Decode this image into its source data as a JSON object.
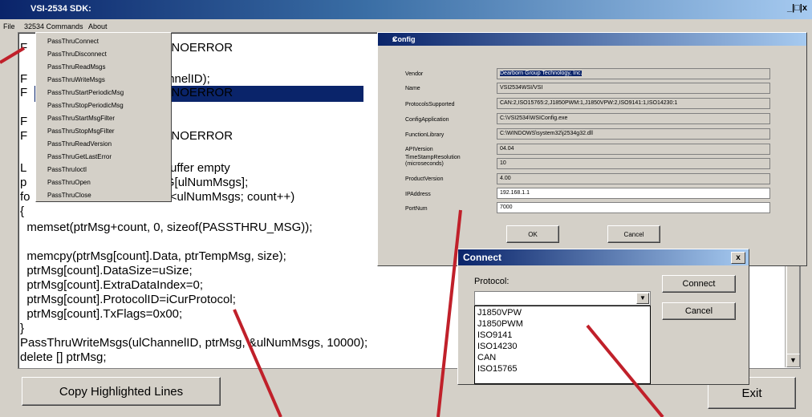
{
  "window": {
    "title": "VSI-2534 SDK:",
    "controls": "_|□|x"
  },
  "menubar": {
    "items": [
      "File",
      "32534 Commands",
      "About"
    ]
  },
  "dropdown": {
    "items": [
      "PassThruConnect",
      "PassThruDisconnect",
      "PassThruReadMsgs",
      "PassThruWriteMsgs",
      "PassThruStartPeriodicMsg",
      "PassThruStopPeriodicMsg",
      "PassThruStartMsgFilter",
      "PassThruStopMsgFilter",
      "PassThruReadVersion",
      "PassThruGetLastError",
      "PassThruIoctl",
      "PassThruOpen",
      "PassThruClose"
    ]
  },
  "code": {
    "lines": [
      "F                                    US_NOERROR",
      "F                                      hannelID);",
      "F                                    US_NOERROR",
      "F",
      "F                                    US_NOERROR",
      "L                                  age buffer empty",
      "p                                  _MSG[ulNumMsgs];",
      "fo                                 count<ulNumMsgs; count++)",
      "{",
      "  memset(ptrMsg+count, 0, sizeof(PASSTHRU_MSG));",
      "  memcpy(ptrMsg[count].Data, ptrTempMsg, size);",
      "  ptrMsg[count].DataSize=uSize;",
      "  ptrMsg[count].ExtraDataIndex=0;",
      "  ptrMsg[count].ProtocolID=iCurProtocol;",
      "  ptrMsg[count].TxFlags=0x00;",
      "}",
      "PassThruWriteMsgs(ulChannelID, ptrMsg, &ulNumMsgs, 10000);",
      "delete [] ptrMsg;"
    ]
  },
  "buttons": {
    "copy": "Copy Highlighted Lines",
    "exit": "Exit"
  },
  "config": {
    "title": "Config",
    "close": "x",
    "fields": [
      {
        "label": "Vendor",
        "value": "Dearborn Group Technology, Inc."
      },
      {
        "label": "Name",
        "value": "VSI2534WSI/VSI"
      },
      {
        "label": "ProtocolsSupported",
        "value": "CAN:2,ISO15765:2,J1850PWM:1,J1850VPW:2,ISO9141:1,ISO14230:1"
      },
      {
        "label": "ConfigApplication",
        "value": "C:\\VSI2534\\WSIConfig.exe"
      },
      {
        "label": "FunctionLibrary",
        "value": "C:\\WINDOWS\\system32\\j2534g32.dll"
      },
      {
        "label": "APIVersion",
        "value": "04.04"
      },
      {
        "label": "TimeStampResolution (microseconds)",
        "value": "10"
      },
      {
        "label": "ProductVersion",
        "value": "4.00"
      },
      {
        "label": "IPAddress",
        "value": "192.168.1.1"
      },
      {
        "label": "PortNum",
        "value": "7000"
      }
    ],
    "ok": "OK",
    "cancel": "Cancel"
  },
  "connect": {
    "title": "Connect",
    "close": "x",
    "protocol_label": "Protocol:",
    "protocol_value": "",
    "options": [
      "J1850VPW",
      "J1850PWM",
      "ISO9141",
      "ISO14230",
      "CAN",
      "ISO15765"
    ],
    "connect_btn": "Connect",
    "cancel_btn": "Cancel"
  },
  "colors": {
    "highlight": "#0a246a",
    "annotation_arrow": "#c0202a"
  }
}
